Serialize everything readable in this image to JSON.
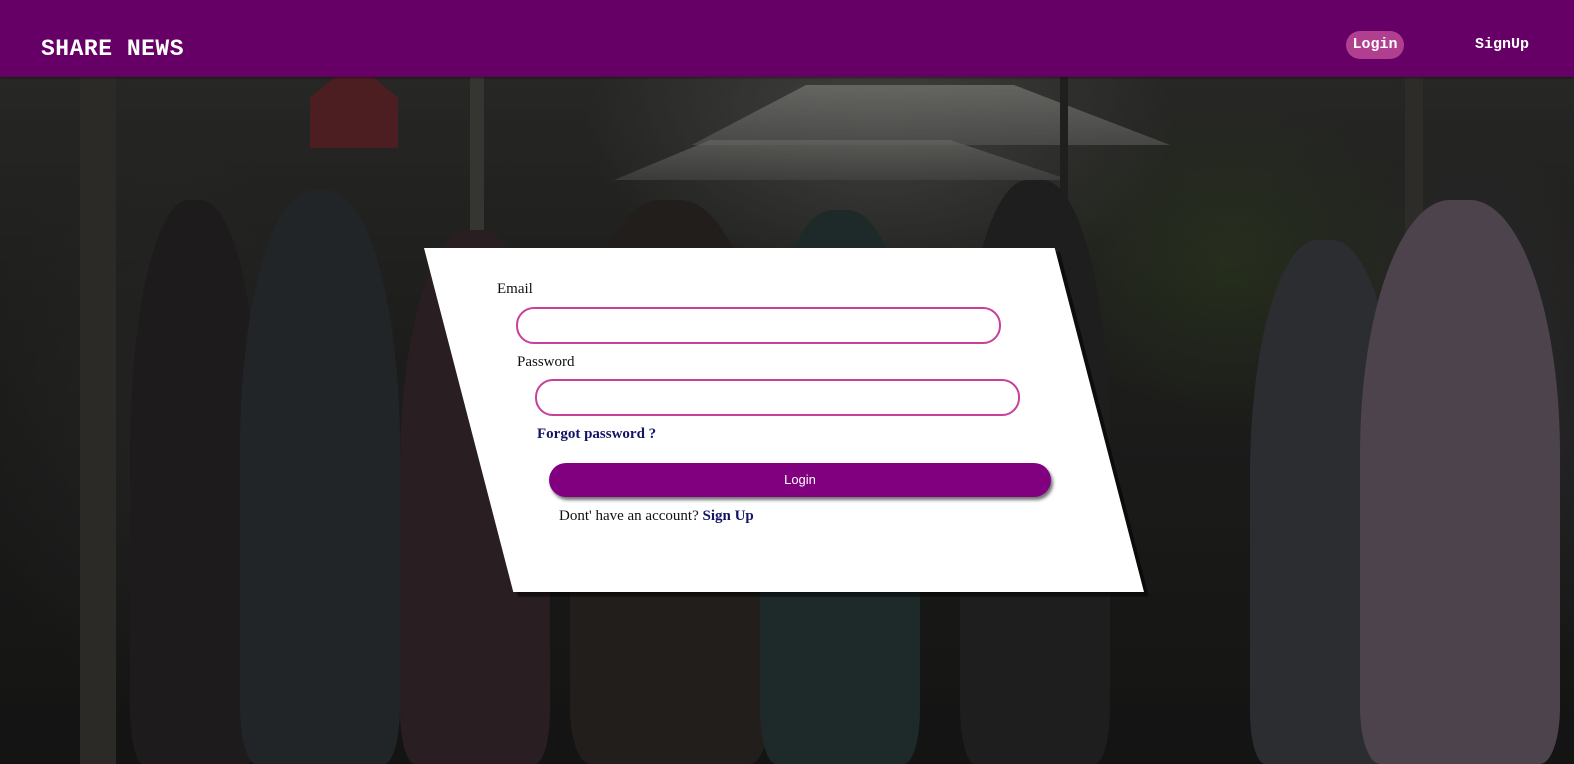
{
  "navbar": {
    "brand": "SHARE NEWS",
    "login_label": "Login",
    "signup_label": "SignUp",
    "color": "#660066",
    "active_pill_color": "#b0408f"
  },
  "login_form": {
    "email_label": "Email",
    "email_value": "",
    "password_label": "Password",
    "password_value": "",
    "forgot_password": "Forgot password ?",
    "submit_label": "Login",
    "no_account_text": "Dont' have an account?",
    "signup_link": "Sign Up",
    "accent_color": "#800080",
    "input_border_color": "#c8409a",
    "link_color": "#141466"
  }
}
